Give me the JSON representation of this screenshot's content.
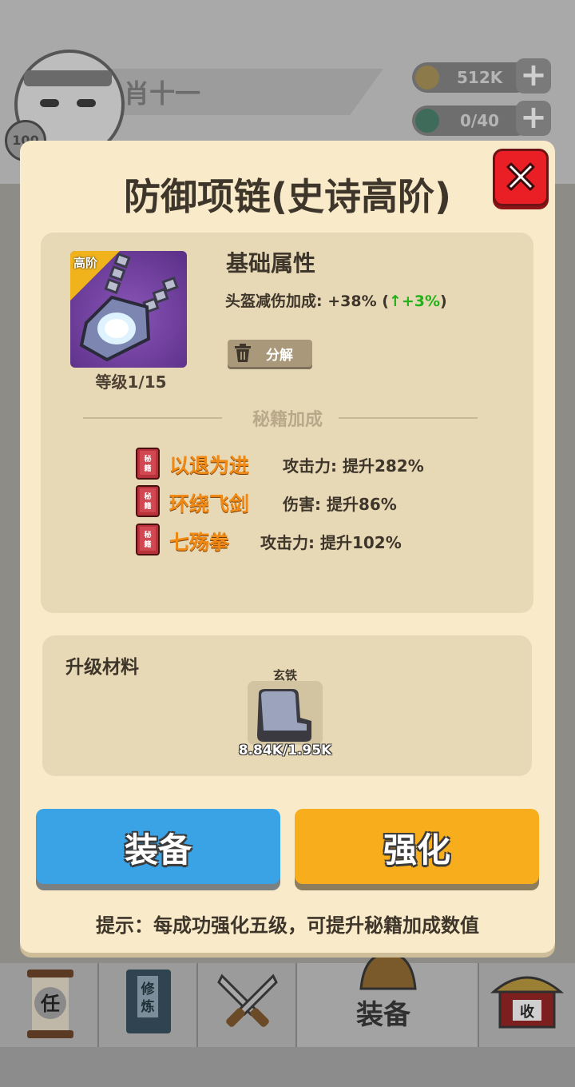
{
  "hud": {
    "player_name": "肖十一",
    "player_level": "100",
    "coins": "512K",
    "gems": "0/40",
    "plus": "+"
  },
  "modal": {
    "title": "防御项链(史诗高阶)",
    "item": {
      "tier_tag": "高阶",
      "level": "等级1/15",
      "icon": "necklace-icon"
    },
    "base_attr_title": "基础属性",
    "stat": {
      "label": "头盔减伤加成: +38% (",
      "arrow": "↑",
      "bonus": "+3%",
      "close": ")"
    },
    "decompose_label": "分解",
    "secret_title": "秘籍加成",
    "secret_book_glyph": "秘籍",
    "skills": [
      {
        "name": "以退为进",
        "effect": "攻击力: 提升282%"
      },
      {
        "name": "环绕飞剑",
        "effect": "伤害: 提升86%"
      },
      {
        "name": "七殇拳",
        "effect": "攻击力: 提升102%"
      }
    ],
    "material_title": "升级材料",
    "material": {
      "name": "玄铁",
      "count": "8.84K/1.95K"
    },
    "equip_label": "装备",
    "enhance_label": "强化",
    "hint": "提示：每成功强化五级，可提升秘籍加成数值"
  },
  "bottom_nav": {
    "task": "任",
    "cultivate": "修炼",
    "equip": "装备",
    "collect": "收"
  },
  "colors": {
    "modal_bg": "#f9ebc9",
    "close_red": "#e91f25",
    "skill_orange": "#f08a15",
    "stat_green": "#21b21a",
    "equip_blue": "#3aa3e6",
    "enhance_orange": "#f7ad1c"
  }
}
